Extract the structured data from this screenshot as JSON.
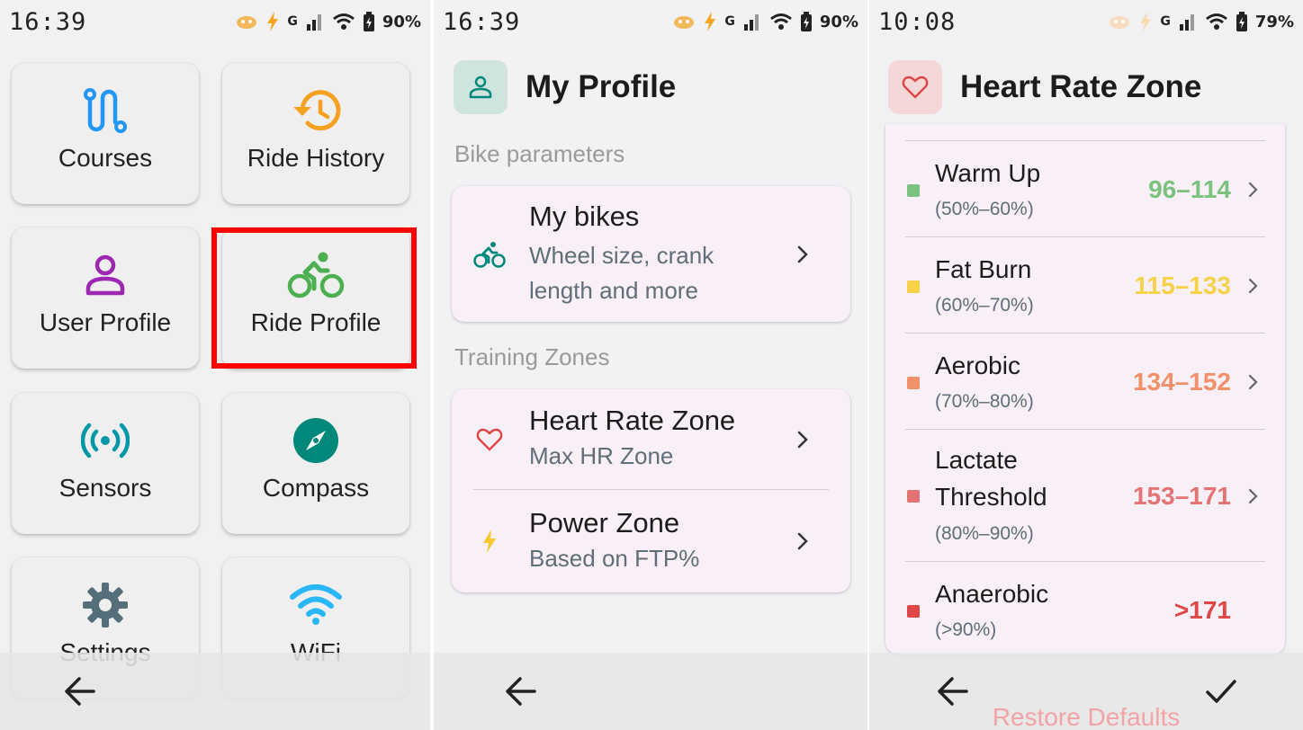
{
  "screen1": {
    "status": {
      "time": "16:39",
      "signal": "G",
      "battery": "90%"
    },
    "tiles": [
      {
        "label": "Courses",
        "icon": "route-icon",
        "color": "#2196f3"
      },
      {
        "label": "Ride History",
        "icon": "history-icon",
        "color": "#f5a020"
      },
      {
        "label": "User Profile",
        "icon": "person-icon",
        "color": "#9c27b0"
      },
      {
        "label": "Ride Profile",
        "icon": "bicycle-icon",
        "color": "#4caf50"
      },
      {
        "label": "Sensors",
        "icon": "sensors-icon",
        "color": "#0097a7"
      },
      {
        "label": "Compass",
        "icon": "compass-icon",
        "color": "#00897b"
      },
      {
        "label": "Settings",
        "icon": "gear-icon",
        "color": "#546e7a"
      },
      {
        "label": "WiFi",
        "icon": "wifi-icon",
        "color": "#29b6f6"
      }
    ]
  },
  "screen2": {
    "status": {
      "time": "16:39",
      "signal": "G",
      "battery": "90%"
    },
    "header": {
      "title": "My Profile",
      "icon": "person-icon",
      "accent": "#00897b"
    },
    "sections": [
      {
        "title": "Bike parameters",
        "items": [
          {
            "title": "My bikes",
            "subtitle": "Wheel size, crank length and more",
            "icon": "bicycle-icon"
          }
        ]
      },
      {
        "title": "Training Zones",
        "items": [
          {
            "title": "Heart Rate Zone",
            "subtitle": "Max HR Zone",
            "icon": "heart-icon"
          },
          {
            "title": "Power Zone",
            "subtitle": "Based on FTP%",
            "icon": "bolt-icon"
          }
        ]
      }
    ]
  },
  "screen3": {
    "status": {
      "time": "10:08",
      "signal": "G",
      "battery": "79%"
    },
    "header": {
      "title": "Heart Rate Zone",
      "icon": "heart-icon"
    },
    "zones": [
      {
        "name": "Warm Up",
        "percent": "(50%–60%)",
        "range": "96–114",
        "color": "#7cc27f",
        "has_chevron": true
      },
      {
        "name": "Fat Burn",
        "percent": "(60%–70%)",
        "range": "115–133",
        "color": "#f7d147",
        "has_chevron": true
      },
      {
        "name": "Aerobic",
        "percent": "(70%–80%)",
        "range": "134–152",
        "color": "#f2906a",
        "has_chevron": true
      },
      {
        "name": "Lactate Threshold",
        "name_lines": [
          "Lactate",
          "Threshold"
        ],
        "percent": "(80%–90%)",
        "range": "153–171",
        "color": "#e57373",
        "has_chevron": true
      },
      {
        "name": "Anaerobic",
        "percent": "(>90%)",
        "range": ">171",
        "color": "#e04848",
        "has_chevron": false
      }
    ],
    "restore_label": "Restore Defaults"
  }
}
